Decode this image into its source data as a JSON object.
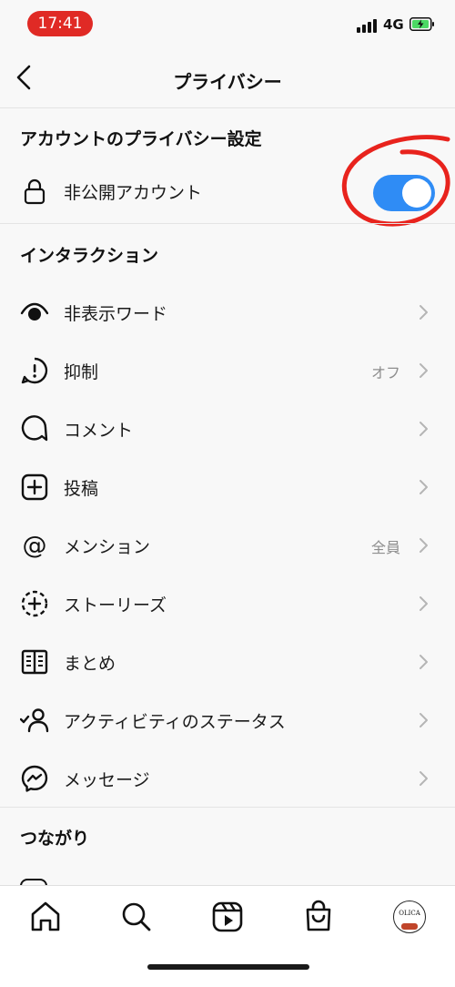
{
  "status_bar": {
    "time": "17:41",
    "network": "4G"
  },
  "header": {
    "title": "プライバシー"
  },
  "account_section": {
    "title": "アカウントのプライバシー設定",
    "private_account": {
      "label": "非公開アカウント",
      "enabled": true
    }
  },
  "interaction_section": {
    "title": "インタラクション",
    "items": [
      {
        "label": "非表示ワード",
        "value": "",
        "icon": "eye-icon"
      },
      {
        "label": "抑制",
        "value": "オフ",
        "icon": "restrict-icon"
      },
      {
        "label": "コメント",
        "value": "",
        "icon": "comment-icon"
      },
      {
        "label": "投稿",
        "value": "",
        "icon": "post-plus-icon"
      },
      {
        "label": "メンション",
        "value": "全員",
        "icon": "at-icon"
      },
      {
        "label": "ストーリーズ",
        "value": "",
        "icon": "story-plus-icon"
      },
      {
        "label": "まとめ",
        "value": "",
        "icon": "guides-icon"
      },
      {
        "label": "アクティビティのステータス",
        "value": "",
        "icon": "activity-status-icon"
      },
      {
        "label": "メッセージ",
        "value": "",
        "icon": "messenger-icon"
      }
    ]
  },
  "connections_section": {
    "title": "つながり"
  },
  "tab_bar": {
    "tabs": [
      "home-icon",
      "search-icon",
      "reels-icon",
      "shop-icon",
      "profile-avatar"
    ],
    "avatar_text": "OLICA"
  },
  "colors": {
    "toggle_on": "#2f8cf5",
    "time_pill": "#e02a25",
    "annotation": "#e8231d"
  }
}
